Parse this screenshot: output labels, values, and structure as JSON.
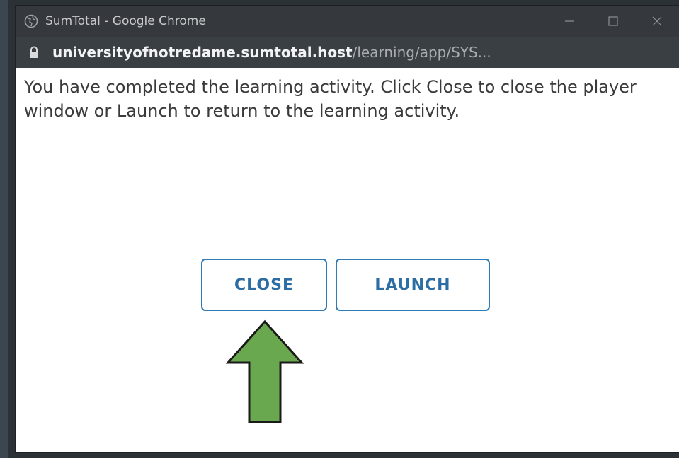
{
  "window": {
    "title": "SumTotal - Google Chrome",
    "url_host": "universityofnotredame.sumtotal.host",
    "url_path": "/learning/app/SYS..."
  },
  "content": {
    "message": "You have completed the learning activity. Click Close to close the player window or Launch to return to the learning activity.",
    "close_label": "CLOSE",
    "launch_label": "LAUNCH"
  },
  "colors": {
    "button_border": "#2e7bb6",
    "button_text": "#2c6da3",
    "arrow_fill": "#6aa84f",
    "titlebar": "#35393d"
  },
  "icons": {
    "title": "globe-icon",
    "url": "lock-icon",
    "controls": [
      "minimize-icon",
      "maximize-icon",
      "close-window-icon"
    ],
    "annotation": "up-arrow-icon"
  }
}
